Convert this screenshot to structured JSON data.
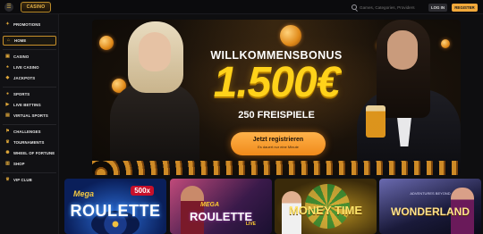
{
  "topbar": {
    "logo_text": "CASINO",
    "search_placeholder": "Games, Categories, Providers",
    "login_label": "LOG IN",
    "register_label": "REGISTER"
  },
  "sidebar": {
    "items": [
      {
        "label": "PROMOTIONS",
        "icon": "gift-icon"
      },
      {
        "label": "HOME",
        "icon": "home-icon",
        "active": true
      },
      {
        "label": "CASINO",
        "icon": "slot-icon"
      },
      {
        "label": "LIVE CASINO",
        "icon": "cards-icon"
      },
      {
        "label": "JACKPOTS",
        "icon": "jackpot-icon"
      },
      {
        "label": "SPORTS",
        "icon": "ball-icon"
      },
      {
        "label": "LIVE BETTING",
        "icon": "live-icon"
      },
      {
        "label": "VIRTUAL SPORTS",
        "icon": "virtual-icon"
      },
      {
        "label": "CHALLENGES",
        "icon": "challenge-icon"
      },
      {
        "label": "TOURNAMENTS",
        "icon": "trophy-icon"
      },
      {
        "label": "WHEEL OF FORTUNE",
        "icon": "wheel-icon"
      },
      {
        "label": "SHOP",
        "icon": "shop-icon"
      },
      {
        "label": "VIP CLUB",
        "icon": "vip-icon"
      }
    ]
  },
  "hero": {
    "title": "WILLKOMMENSBONUS",
    "amount": "1.500€",
    "spins": "250 FREISPIELE",
    "cta_label": "Jetzt registrieren",
    "cta_sub": "Es dauert nur eine Minute"
  },
  "games": [
    {
      "pre": "Mega",
      "title": "ROULETTE",
      "badge": "500x"
    },
    {
      "pre": "MEGA",
      "title": "ROULETTE",
      "sub": "LIVE"
    },
    {
      "title": "MONEY TIME"
    },
    {
      "pre": "ADVENTURES BEYOND",
      "title": "WONDERLAND"
    }
  ],
  "colors": {
    "accent": "#f2a93b",
    "bonus_yellow": "#ffd21a",
    "background": "#0e0e10"
  }
}
